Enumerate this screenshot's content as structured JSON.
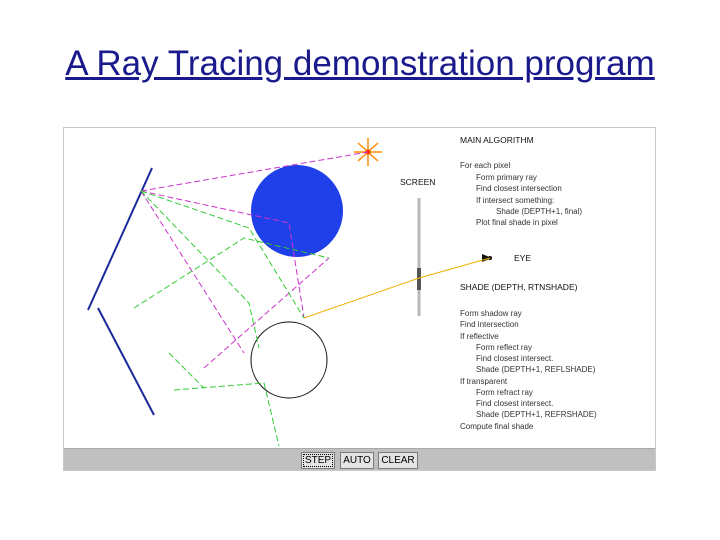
{
  "slide": {
    "title": "A Ray Tracing demonstration program"
  },
  "scene": {
    "screen_label": "SCREEN",
    "eye_label": "EYE",
    "colors": {
      "sphere_blue": "#1f3fe8",
      "ray_primary": "#f0b000",
      "ray_reflect": "#cc33cc",
      "ray_shadow": "#33cc33",
      "mirror": "#1a2a9a",
      "light": "#ff8800"
    }
  },
  "algorithm": {
    "main_title": "MAIN ALGORITHM",
    "main_lines": [
      "For each pixel",
      "Form primary ray",
      "Find closest intersection",
      "If intersect something:",
      "Shade (DEPTH+1, final)",
      "Plot final shade in pixel"
    ],
    "shade_title": "SHADE (DEPTH, RTNSHADE)",
    "shade_lines": [
      "Form shadow ray",
      "Find intersection",
      "If reflective",
      "Form reflect ray",
      "Find closest intersect.",
      "Shade (DEPTH+1, REFLSHADE)",
      "If transparent",
      "Form refract ray",
      "Find closest intersect.",
      "Shade (DEPTH+1, REFRSHADE)",
      "Compute final shade"
    ]
  },
  "toolbar": {
    "step_label": "STEP",
    "auto_label": "AUTO",
    "clear_label": "CLEAR"
  }
}
